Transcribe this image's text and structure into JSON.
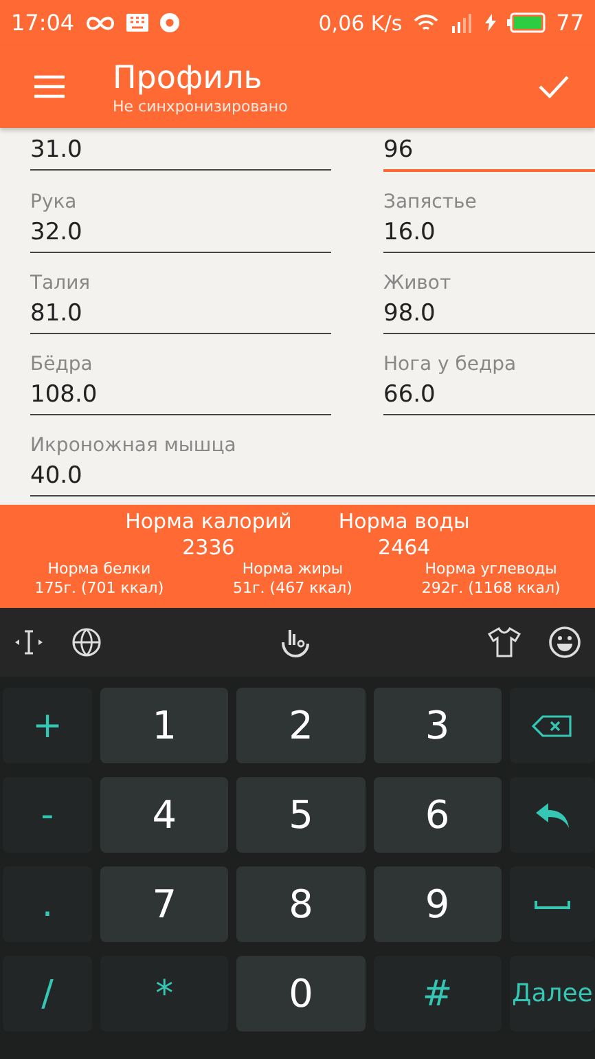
{
  "status_bar": {
    "time": "17:04",
    "speed": "0,06 K/s",
    "battery": "77"
  },
  "app_bar": {
    "title": "Профиль",
    "subtitle": "Не синхронизировано"
  },
  "fields": [
    {
      "value": "31.0",
      "focused": false
    },
    {
      "value": "96",
      "focused": true
    },
    {
      "label": "Рука",
      "value": "32.0",
      "focused": false
    },
    {
      "label": "Запястье",
      "value": "16.0",
      "focused": false
    },
    {
      "label": "Талия",
      "value": "81.0",
      "focused": false
    },
    {
      "label": "Живот",
      "value": "98.0",
      "focused": false
    },
    {
      "label": "Бёдра",
      "value": "108.0",
      "focused": false
    },
    {
      "label": "Нога у бедра",
      "value": "66.0",
      "focused": false
    },
    {
      "label": "Икроножная мышца",
      "value": "40.0",
      "focused": false,
      "wide": true
    }
  ],
  "summary": {
    "main": [
      {
        "label": "Норма калорий",
        "value": "2336"
      },
      {
        "label": "Норма воды",
        "value": "2464"
      }
    ],
    "macros": [
      {
        "label": "Норма белки",
        "value": "175г. (701 ккал)"
      },
      {
        "label": "Норма жиры",
        "value": "51г. (467 ккал)"
      },
      {
        "label": "Норма углеводы",
        "value": "292г. (1168 ккал)"
      }
    ]
  },
  "keys": [
    {
      "kind": "symbol",
      "label": "+"
    },
    {
      "kind": "digit",
      "label": "1"
    },
    {
      "kind": "digit",
      "label": "2"
    },
    {
      "kind": "digit",
      "label": "3"
    },
    {
      "kind": "backspace"
    },
    {
      "kind": "symbol",
      "label": "-"
    },
    {
      "kind": "digit",
      "label": "4"
    },
    {
      "kind": "digit",
      "label": "5"
    },
    {
      "kind": "digit",
      "label": "6"
    },
    {
      "kind": "enter"
    },
    {
      "kind": "symbol",
      "label": "."
    },
    {
      "kind": "digit",
      "label": "7"
    },
    {
      "kind": "digit",
      "label": "8"
    },
    {
      "kind": "digit",
      "label": "9"
    },
    {
      "kind": "space"
    },
    {
      "kind": "symbol",
      "label": "/"
    },
    {
      "kind": "symbol",
      "label": "*"
    },
    {
      "kind": "digit",
      "label": "0"
    },
    {
      "kind": "symbol",
      "label": "#"
    },
    {
      "kind": "text",
      "label": "Далее"
    }
  ]
}
